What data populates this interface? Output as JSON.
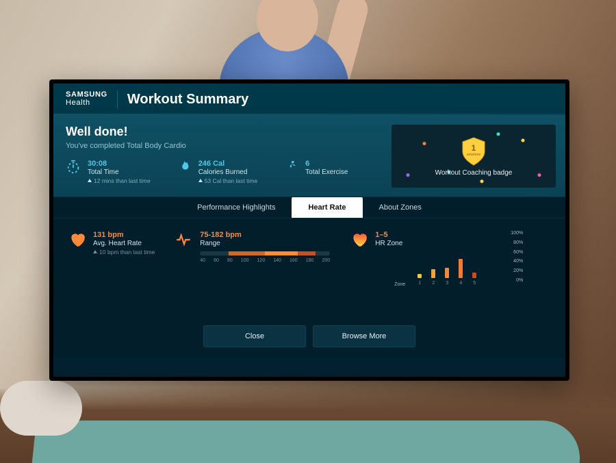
{
  "brand": {
    "line1": "SAMSUNG",
    "line2": "Health"
  },
  "page_title": "Workout Summary",
  "congrats": {
    "headline": "Well done!",
    "subtext": "You've completed Total Body Cardio"
  },
  "stats": {
    "total_time": {
      "value": "30:08",
      "label": "Total Time",
      "delta": "12 mins than last time"
    },
    "calories": {
      "value": "246 Cal",
      "label": "Calories Burned",
      "delta": "53 Cal than last time"
    },
    "exercise": {
      "value": "6",
      "label": "Total Exercise",
      "delta": ""
    }
  },
  "badge": {
    "number": "1",
    "unit": "sessions",
    "label": "Workout Coaching badge"
  },
  "tabs": [
    "Performance Highlights",
    "Heart Rate",
    "About Zones"
  ],
  "active_tab_index": 1,
  "heart_rate": {
    "avg": {
      "value": "131 bpm",
      "label": "Avg. Heart Rate",
      "delta": "10 bpm than last time"
    },
    "range": {
      "value": "75-182 bpm",
      "label": "Range"
    },
    "zone": {
      "value": "1–5",
      "label": "HR Zone"
    }
  },
  "chart_data": {
    "range_bar": {
      "type": "bar",
      "min": 40,
      "max": 200,
      "ticks": [
        "40",
        "60",
        "80",
        "100",
        "120",
        "140",
        "160",
        "180",
        "200"
      ],
      "highlight_start": 75,
      "highlight_end": 182,
      "segments": [
        {
          "start": 75,
          "end": 120,
          "color": "#c96a2a"
        },
        {
          "start": 120,
          "end": 160,
          "color": "#ff8a3a"
        },
        {
          "start": 160,
          "end": 182,
          "color": "#c0522a"
        }
      ]
    },
    "zone_chart": {
      "type": "bar",
      "xlabel": "Zone",
      "categories": [
        "1",
        "2",
        "3",
        "4",
        "5"
      ],
      "values_pct": [
        8,
        18,
        22,
        40,
        12
      ],
      "colors": [
        "#f2c84b",
        "#f0a43a",
        "#f08a3a",
        "#ff7a2a",
        "#d9451e"
      ],
      "ylabels": [
        "100%",
        "80%",
        "60%",
        "40%",
        "20%",
        "0%"
      ],
      "ylim": [
        0,
        100
      ]
    }
  },
  "buttons": {
    "close": "Close",
    "browse": "Browse More"
  }
}
